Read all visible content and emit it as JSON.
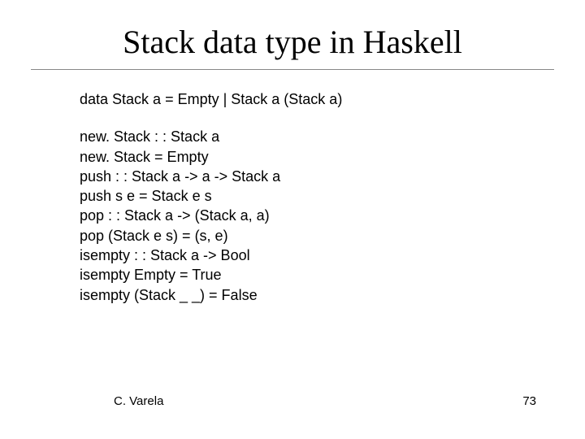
{
  "title": "Stack data type in Haskell",
  "decl": "data Stack a  = Empty | Stack a (Stack a)",
  "lines": [
    "new. Stack : : Stack a",
    "new. Stack = Empty",
    "push : : Stack a -> a -> Stack a",
    "push s e = Stack e s",
    "pop : : Stack a -> (Stack a, a)",
    "pop (Stack e s) = (s, e)",
    "isempty : : Stack a -> Bool",
    "isempty Empty = True",
    "isempty (Stack _ _) = False"
  ],
  "footer": {
    "author": "C. Varela",
    "page": "73"
  }
}
